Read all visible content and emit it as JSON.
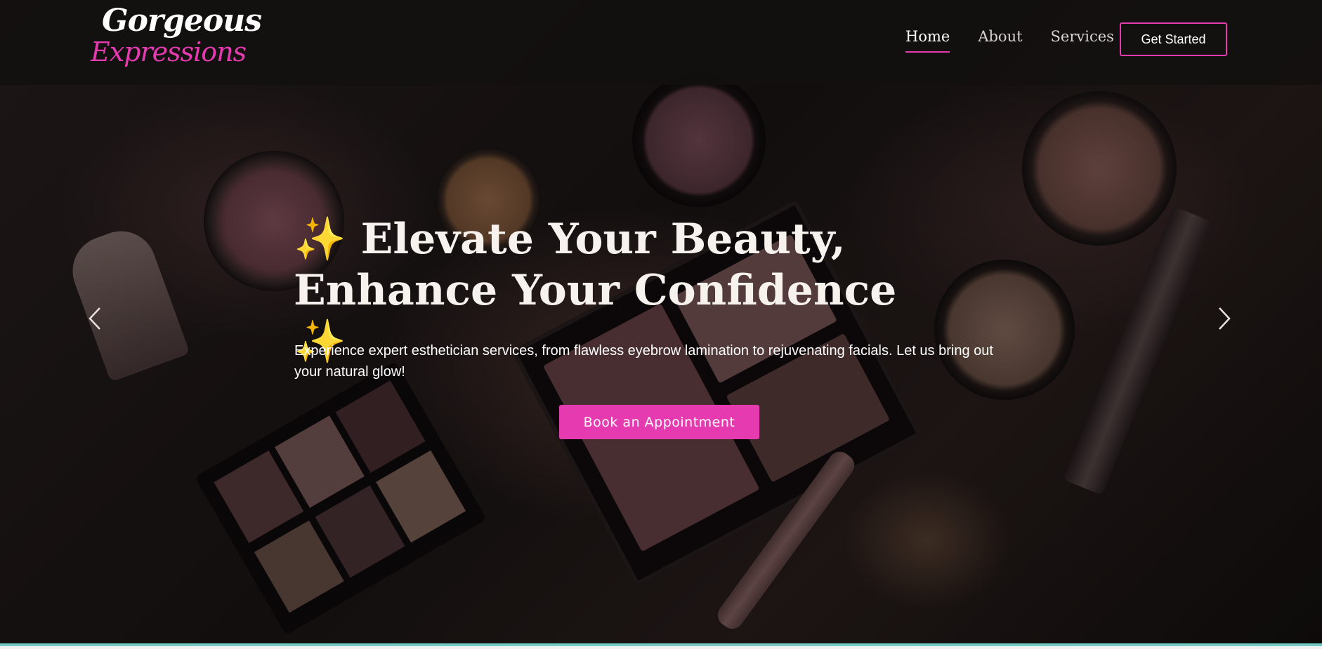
{
  "brand": {
    "logo_line1": "Gorgeous",
    "logo_line2": "Expressions",
    "accent_color": "#e63bb0"
  },
  "nav": {
    "items": [
      {
        "label": "Home",
        "active": true
      },
      {
        "label": "About",
        "active": false
      },
      {
        "label": "Services",
        "active": false
      }
    ],
    "cta_label": "Get Started"
  },
  "hero": {
    "sparkle_left": "✨",
    "headline": "Elevate Your Beauty, Enhance Your Confidence",
    "sparkle_right": "✨",
    "subtext": "Experience expert esthetician services, from flawless eyebrow lamination to rejuvenating facials. Let us bring out your natural glow!",
    "button_label": "Book an Appointment",
    "prev_icon": "chevron-left-icon",
    "next_icon": "chevron-right-icon"
  }
}
